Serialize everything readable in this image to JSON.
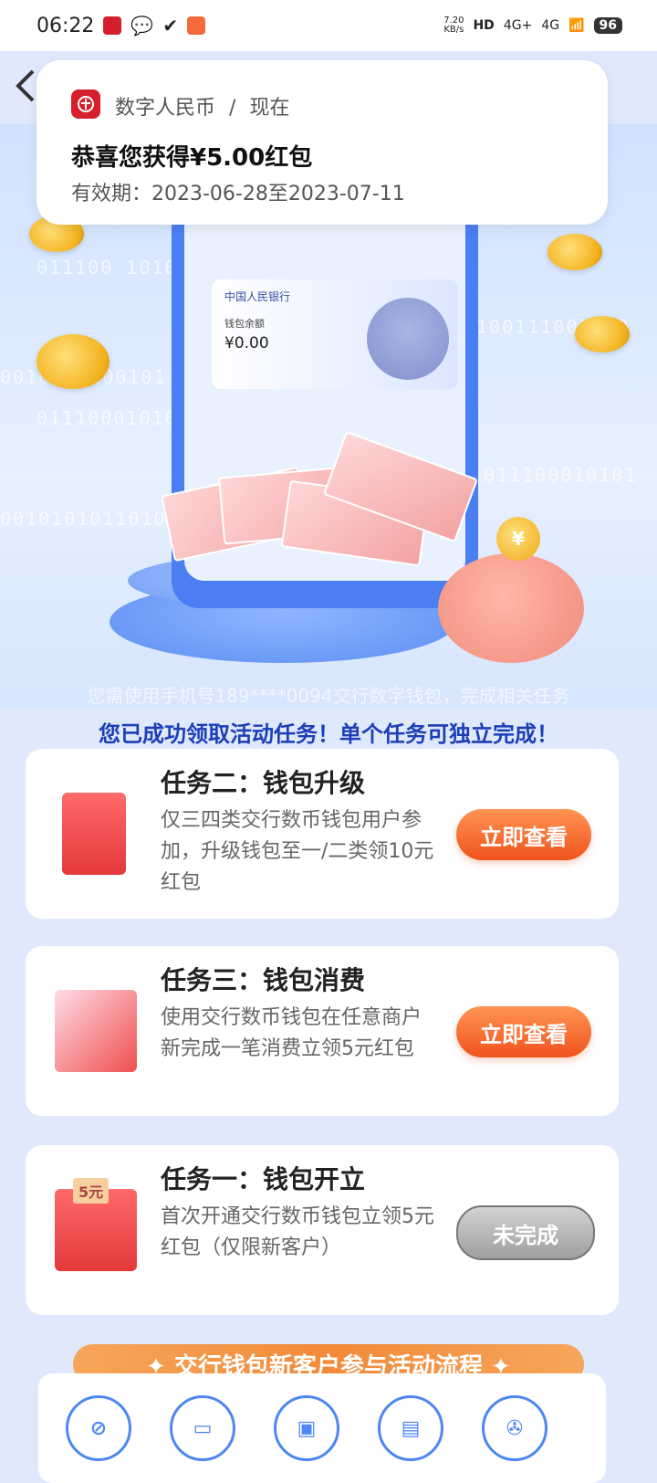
{
  "status_bar": {
    "time": "06:22",
    "network_speed_value": "7.20",
    "network_speed_unit": "KB/s",
    "signal1": "4G+",
    "signal2": "4G",
    "battery": "96"
  },
  "notification": {
    "app_name": "数字人民币",
    "separator": "/",
    "when": "现在",
    "title": "恭喜您获得¥5.00红包",
    "validity": "有效期：2023-06-28至2023-07-11"
  },
  "hero": {
    "card_bank": "中国人民银行",
    "card_balance_label": "钱包余额",
    "card_balance": "¥0.00",
    "coin_symbol": "¥"
  },
  "info": {
    "line1": "您需使用手机号189****0094交行数字钱包，完成相关任务",
    "line2": "您已成功领取活动任务！单个任务可独立完成！"
  },
  "tasks": [
    {
      "title": "任务二：钱包升级",
      "desc": "仅三四类交行数币钱包用户参加，升级钱包至一/二类领10元红包",
      "button": "立即查看"
    },
    {
      "title": "任务三：钱包消费",
      "desc": "使用交行数币钱包在任意商户新完成一笔消费立领5元红包",
      "button": "立即查看"
    },
    {
      "title": "任务一：钱包开立",
      "desc": "首次开通交行数币钱包立领5元红包（仅限新客户）",
      "button": "未完成",
      "wallet_badge": "5元"
    }
  ],
  "flow": {
    "banner": "✦ 交行钱包新客户参与活动流程 ✦"
  },
  "colors": {
    "accent_orange": "#f0531c",
    "brand_blue": "#1c3fb7",
    "red_icon": "#d51f2c"
  }
}
